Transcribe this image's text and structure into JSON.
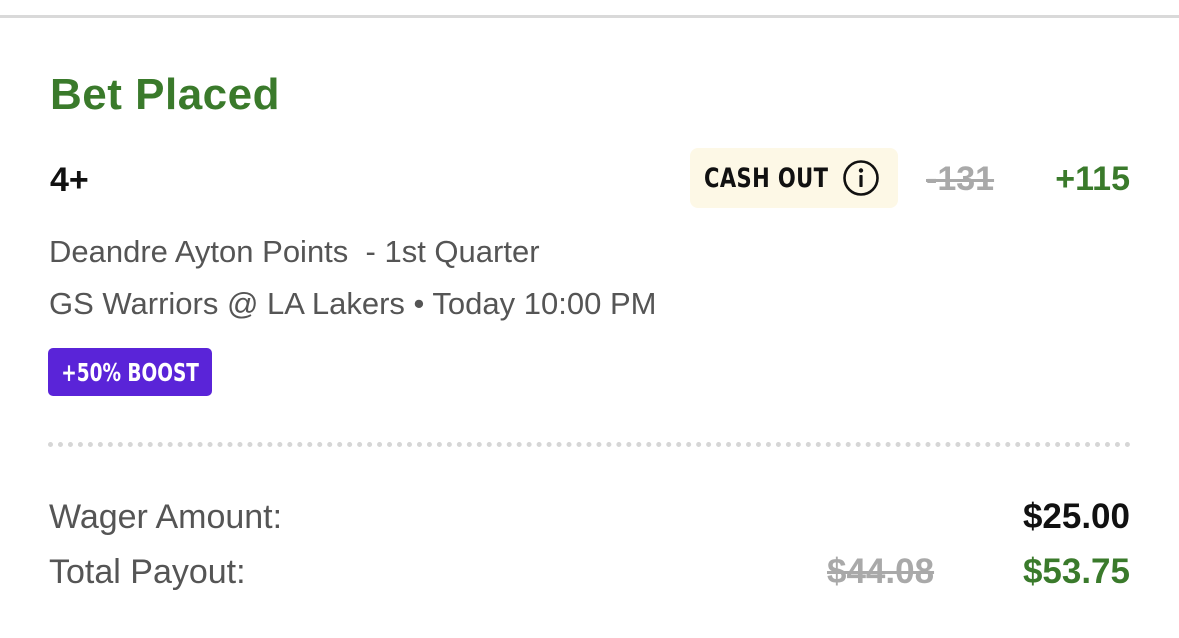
{
  "bet": {
    "title": "Bet Placed",
    "selection": "4+",
    "cash_out_label": "CASH OUT",
    "cash_out_icon": "info-icon",
    "odds_original": "-131",
    "odds_boosted": "+115",
    "market": "Deandre Ayton Points  - 1st Quarter",
    "event": "GS Warriors @ LA Lakers • Today 10:00 PM",
    "boost_label": "+50% BOOST"
  },
  "summary": {
    "wager_label": "Wager Amount:",
    "wager_value": "$25.00",
    "payout_label": "Total Payout:",
    "payout_original": "$44.08",
    "payout_boosted": "$53.75"
  },
  "colors": {
    "accent_green": "#3a7a2b",
    "boost_purple": "#5a24d8",
    "cashout_bg": "#fdf8e6",
    "strikethrough_gray": "#a9a9a9"
  }
}
